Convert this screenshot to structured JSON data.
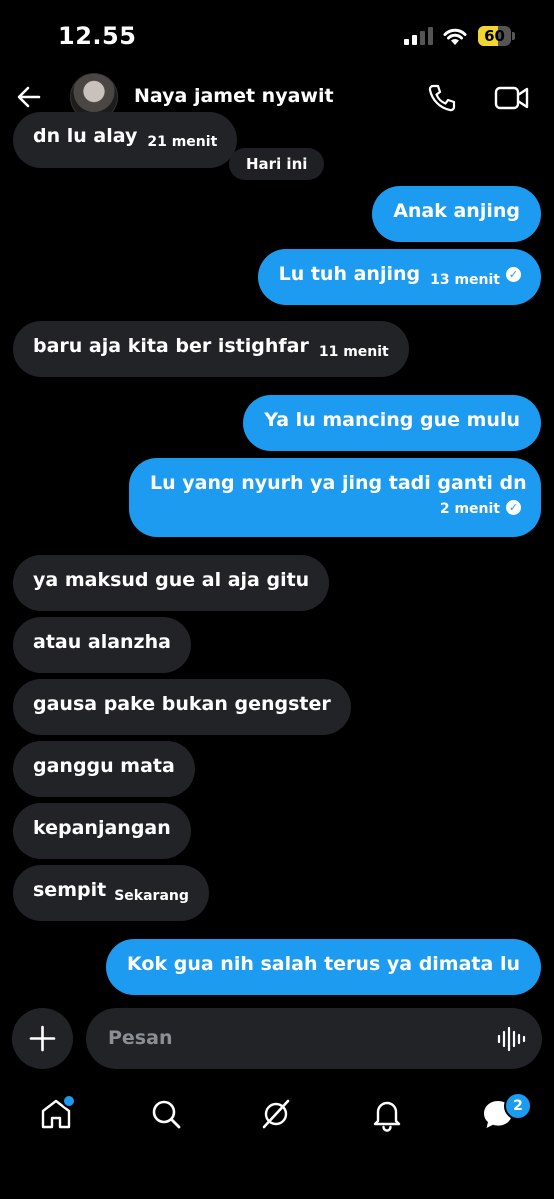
{
  "status_bar": {
    "time": "12.55",
    "battery": "60",
    "battery_level": 0.6
  },
  "header": {
    "contact_name": "Naya jamet nyawit"
  },
  "day_separator": "Hari ini",
  "messages": [
    {
      "side": "in",
      "text": "dn lu alay",
      "time": "21 menit"
    },
    {
      "side": "out",
      "text": "Anak anjing"
    },
    {
      "side": "out",
      "text": "Lu tuh anjing",
      "time": "13 menit",
      "read": true
    },
    {
      "side": "in",
      "text": "baru aja kita ber istighfar",
      "time": "11 menit"
    },
    {
      "side": "out",
      "text": "Ya lu mancing gue mulu"
    },
    {
      "side": "out",
      "text": "Lu yang nyurh ya jing tadi ganti dn",
      "time": "2 menit",
      "read": true
    },
    {
      "side": "in",
      "text": "ya maksud gue al aja gitu"
    },
    {
      "side": "in",
      "text": "atau alanzha"
    },
    {
      "side": "in",
      "text": "gausa pake bukan gengster"
    },
    {
      "side": "in",
      "text": "ganggu mata"
    },
    {
      "side": "in",
      "text": "kepanjangan"
    },
    {
      "side": "in",
      "text": "sempit",
      "time": "Sekarang"
    },
    {
      "side": "out",
      "text": "Kok gua nih salah terus ya dimata lu"
    }
  ],
  "composer": {
    "placeholder": "Pesan"
  },
  "tab_bar": {
    "items": [
      "home-icon",
      "search-icon",
      "grok-icon",
      "notifications-icon",
      "messages-icon"
    ],
    "messages_badge": "2"
  },
  "colors": {
    "accent": "#1d9bf0",
    "incoming_bubble": "#212327",
    "background": "#000000"
  }
}
